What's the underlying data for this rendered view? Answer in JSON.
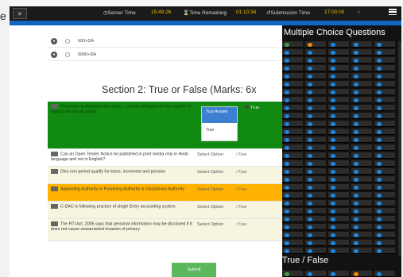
{
  "edge_char": "e",
  "topbar": {
    "menu_label": ">",
    "server_time_label": "Server Time",
    "server_time_value": "15:49:26",
    "time_remaining_label": "Time Remaining",
    "time_remaining_value": "01:10:34",
    "submission_time_label": "Submission Time",
    "submission_time_value": "17:00:00"
  },
  "options": [
    {
      "num": "",
      "text": "600+DA"
    },
    {
      "num": "",
      "text": "5000+DA"
    }
  ],
  "section_title": "Section 2: True or False (Marks: 6x",
  "questions": [
    {
      "text": "Promotion to Assistant Accounts ... can be delegated to the supplier in India to furnish accounts",
      "selected": "Your Answer",
      "dropdown_options": [
        "Your Answer",
        "True"
      ],
      "answer_label": "True",
      "state": "answered"
    },
    {
      "text": "Can an Open Tender Notice be published in print media only in Hindi language and not in English?",
      "select_label": "Select Option",
      "answer_label": "True",
      "state": "default"
    },
    {
      "text": "Dies non period qualify for leave, increment and pension",
      "select_label": "Select Option",
      "answer_label": "True",
      "state": "default"
    },
    {
      "text": "Appointing Authority or Punishing Authority is Disciplinary Authority",
      "select_label": "Select Option",
      "answer_label": "True",
      "state": "marked"
    },
    {
      "text": "C-DAC is following practice of single Entry accounting system.",
      "select_label": "Select Option",
      "answer_label": "True",
      "state": "default"
    },
    {
      "text": "The RTI Act, 2005 says that personal information may be disclosed if it does not cause unwarranted invasion of privacy",
      "select_label": "Select Option",
      "answer_label": "True",
      "state": "default"
    }
  ],
  "submit_label": "Submit",
  "right_panel": {
    "mcq_title": "Multiple Choice Questions",
    "tf_title": "True / False",
    "mcq_rows": 26,
    "mcq_cols": 5,
    "answered_color": "#43a047",
    "marked_color": "#fb8c00",
    "unvisited_color": "#1e88e5"
  },
  "colors": {
    "answered_bg": "#108a10",
    "marked_bg": "#ffb300",
    "accent_blue": "#1565c0",
    "submit_bg": "#5cb85c"
  }
}
